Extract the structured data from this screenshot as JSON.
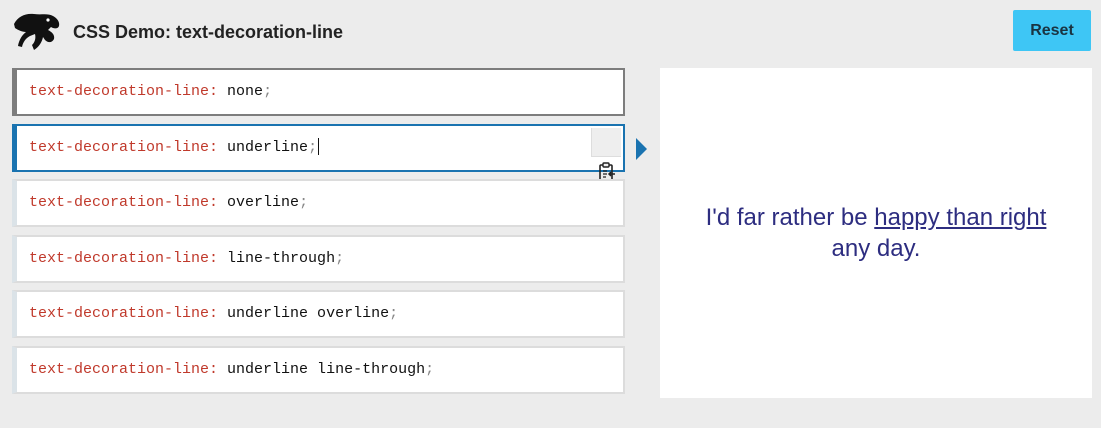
{
  "header": {
    "title": "CSS Demo: text-decoration-line",
    "reset_label": "Reset"
  },
  "choices": [
    {
      "property": "text-decoration-line",
      "value": "none"
    },
    {
      "property": "text-decoration-line",
      "value": "underline"
    },
    {
      "property": "text-decoration-line",
      "value": "overline"
    },
    {
      "property": "text-decoration-line",
      "value": "line-through"
    },
    {
      "property": "text-decoration-line",
      "value": "underline overline"
    },
    {
      "property": "text-decoration-line",
      "value": "underline line-through"
    }
  ],
  "selected_index": 1,
  "output": {
    "before": "I'd far rather be ",
    "decorated": "happy than right",
    "after": " any day."
  },
  "colors": {
    "accent": "#1a73b0",
    "reset_bg": "#3ec6f5",
    "property": "#c0392b",
    "output_text": "#2d2d80"
  },
  "icons": {
    "logo": "mdn-dinosaur-logo",
    "copy": "clipboard-copy-icon",
    "indicator": "triangle-right-icon"
  }
}
